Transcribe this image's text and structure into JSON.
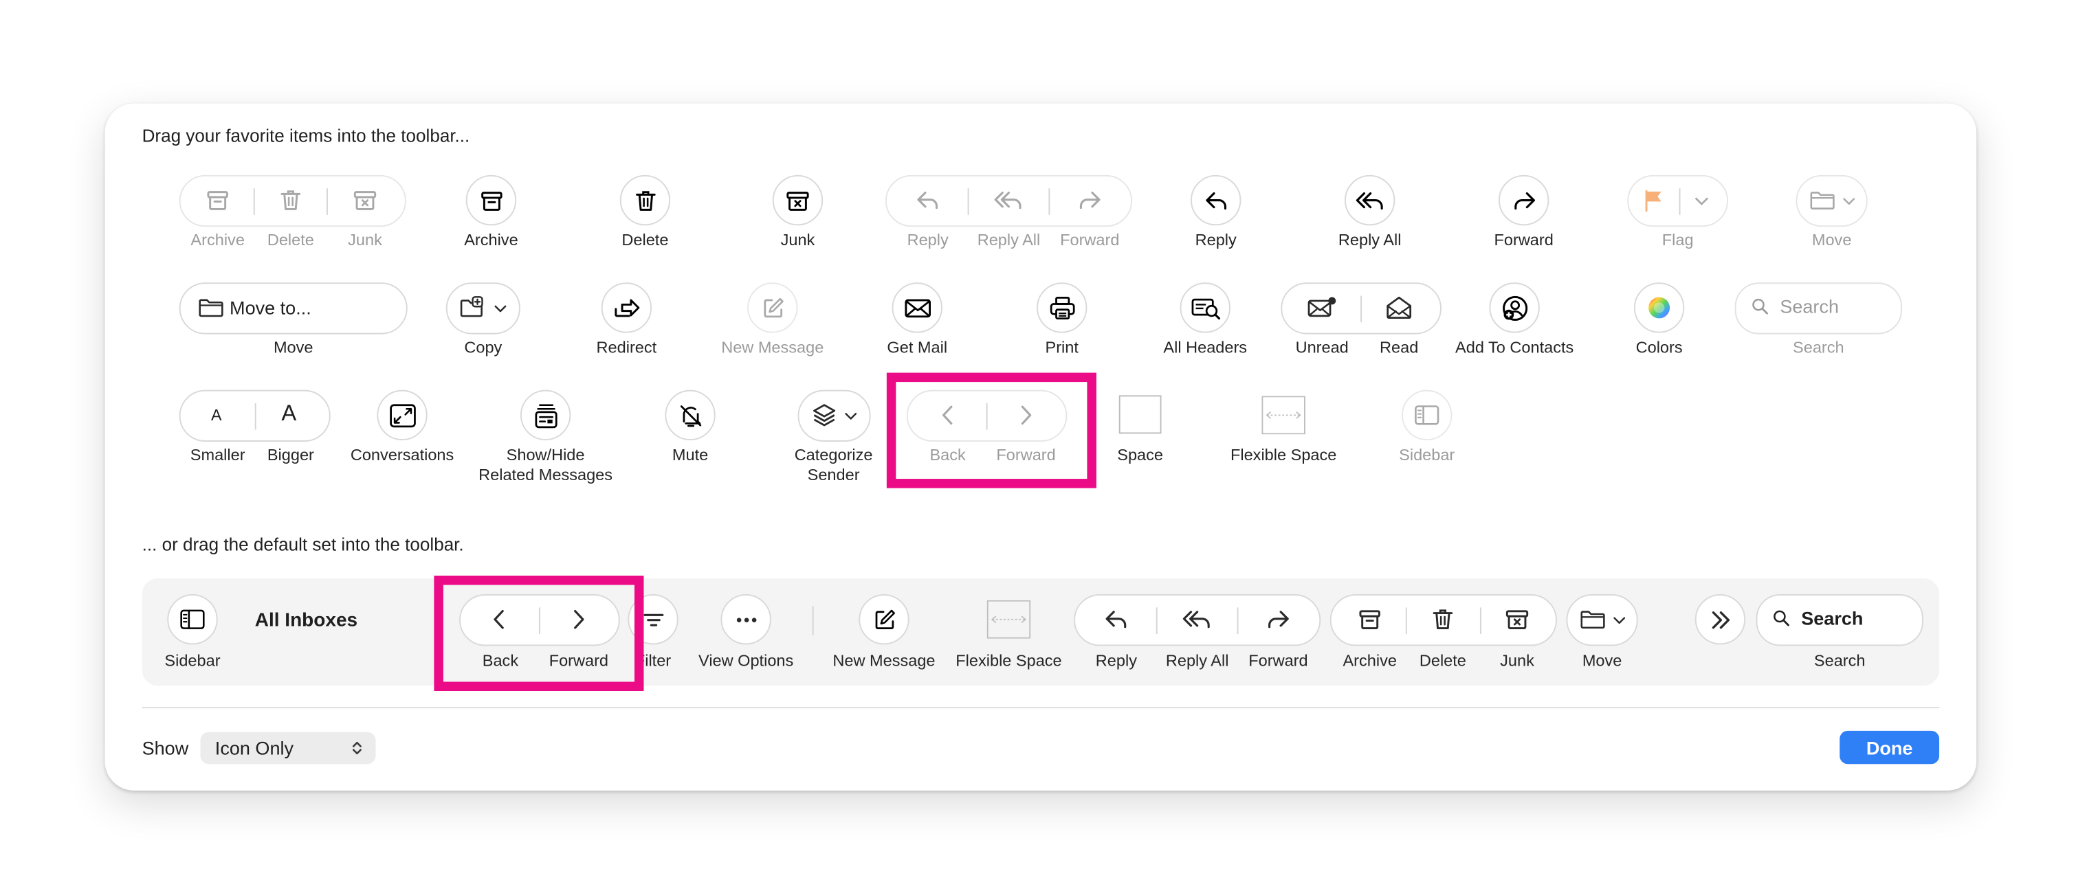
{
  "window": {
    "intro_text": "Drag your favorite items into the toolbar...",
    "default_set_text": "... or drag the default set into the toolbar."
  },
  "palette": {
    "archive_delete_junk": [
      "Archive",
      "Delete",
      "Junk"
    ],
    "archive": "Archive",
    "delete": "Delete",
    "junk": "Junk",
    "reply_group": [
      "Reply",
      "Reply All",
      "Forward"
    ],
    "reply": "Reply",
    "reply_all": "Reply All",
    "forward": "Forward",
    "flag": "Flag",
    "move_menu": "Move",
    "move_to_button": "Move to...",
    "move": "Move",
    "copy": "Copy",
    "redirect": "Redirect",
    "new_message": "New Message",
    "get_mail": "Get Mail",
    "print": "Print",
    "all_headers": "All Headers",
    "unread": "Unread",
    "read": "Read",
    "add_to_contacts": "Add To Contacts",
    "colors": "Colors",
    "search_placeholder": "Search",
    "search": "Search",
    "smaller": "Smaller",
    "bigger": "Bigger",
    "font_small_glyph": "A",
    "font_big_glyph": "A",
    "conversations": "Conversations",
    "show_hide_line1": "Show/Hide",
    "show_hide_line2": "Related Messages",
    "mute": "Mute",
    "categorize_line1": "Categorize",
    "categorize_line2": "Sender",
    "back": "Back",
    "forward_nav": "Forward",
    "space": "Space",
    "flexible_space": "Flexible Space",
    "sidebar": "Sidebar"
  },
  "default_toolbar": {
    "sidebar": "Sidebar",
    "mailbox_title": "All Inboxes",
    "back": "Back",
    "forward_nav": "Forward",
    "filter": "Filter",
    "view_options": "View Options",
    "new_message": "New Message",
    "flexible_space": "Flexible Space",
    "reply": "Reply",
    "reply_all": "Reply All",
    "forward": "Forward",
    "archive": "Archive",
    "delete": "Delete",
    "junk": "Junk",
    "move": "Move",
    "search_text": "Search",
    "search": "Search"
  },
  "footer": {
    "show_label": "Show",
    "show_value": "Icon Only",
    "done": "Done"
  },
  "colors": {
    "highlight": "#ec0b86",
    "done_button": "#2f7ff6",
    "flag": "#f7b078"
  }
}
